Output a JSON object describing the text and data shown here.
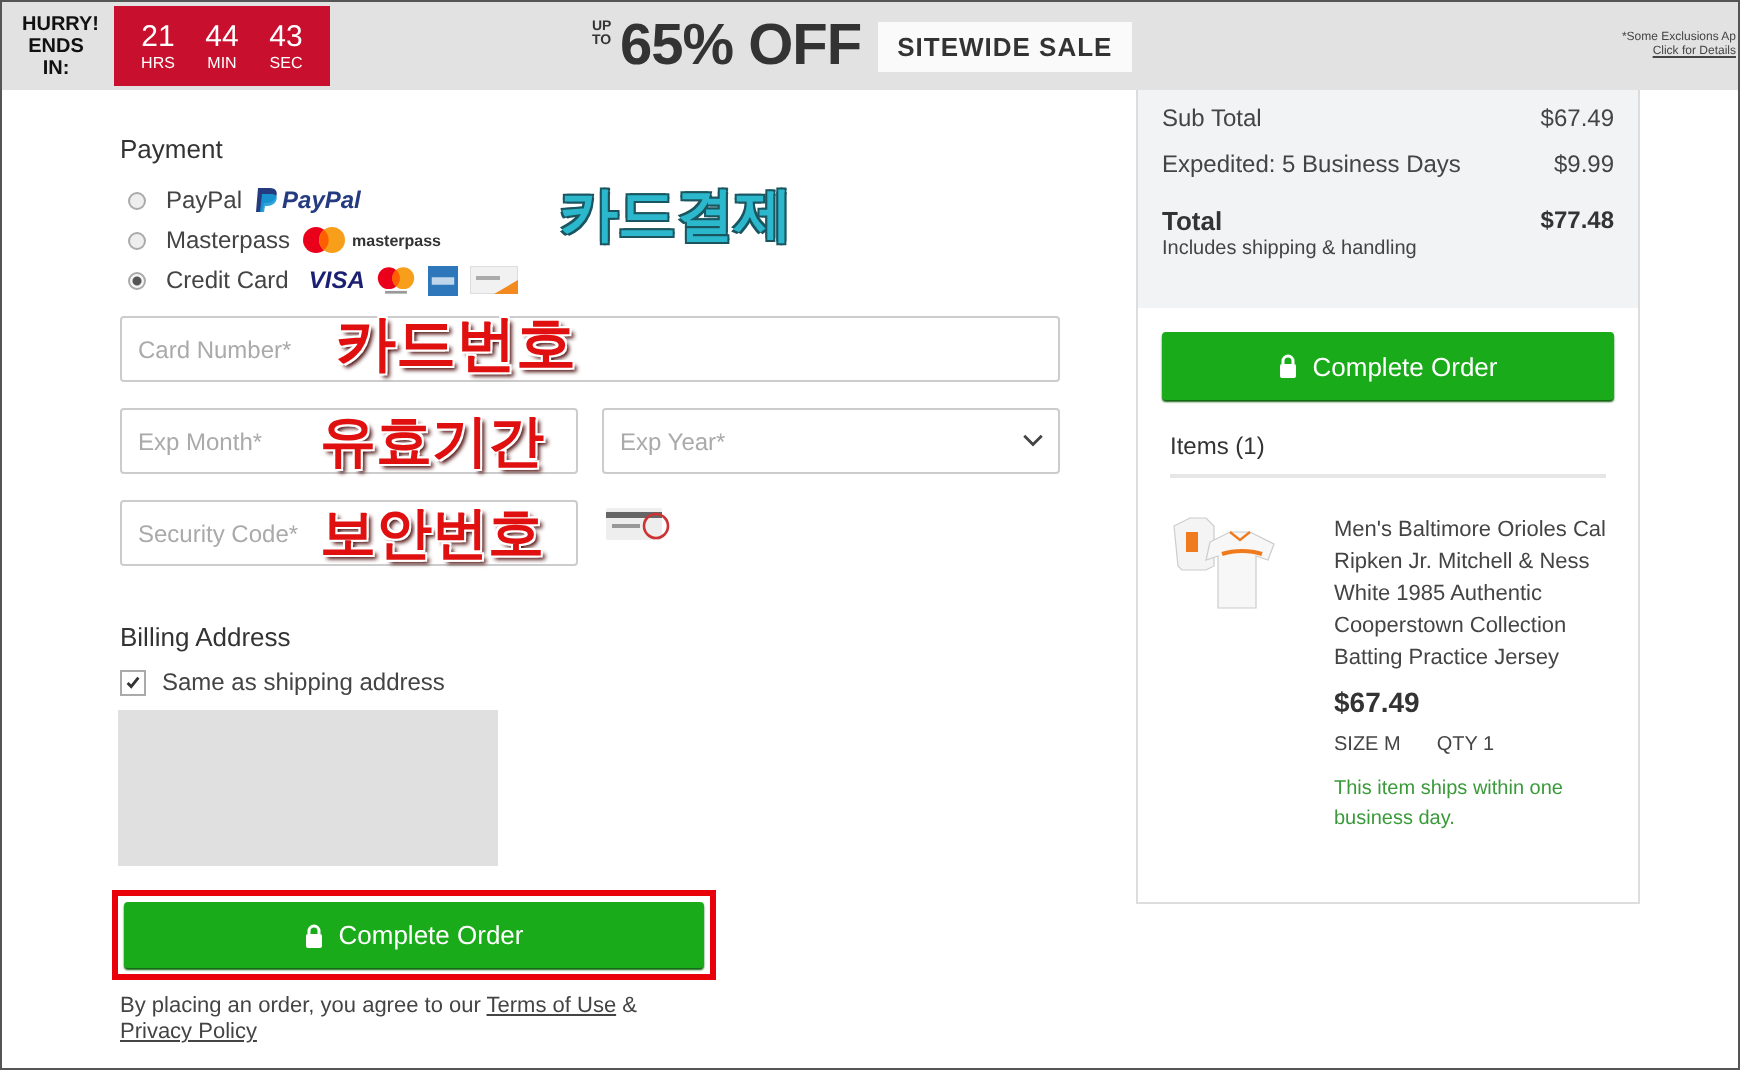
{
  "banner": {
    "hurry": "HURRY! ENDS IN:",
    "countdown": [
      {
        "value": "21",
        "unit": "HRS"
      },
      {
        "value": "44",
        "unit": "MIN"
      },
      {
        "value": "43",
        "unit": "SEC"
      }
    ],
    "up_to": "UP TO",
    "offer": "65% OFF",
    "sale": "SITEWIDE SALE",
    "fine_print": "*Some Exclusions Ap",
    "details_link": "Click for Details"
  },
  "payment": {
    "title": "Payment",
    "methods": [
      {
        "label": "PayPal",
        "kind": "paypal",
        "logo_text": "PayPal",
        "selected": false
      },
      {
        "label": "Masterpass",
        "kind": "masterpass",
        "logo_text": "masterpass",
        "selected": false
      },
      {
        "label": "Credit Card",
        "kind": "cards",
        "logo_text": "VISA",
        "selected": true
      }
    ],
    "methods_annotation": {
      "text": "카드결제",
      "color": "#2bb8cc"
    },
    "card_number": {
      "placeholder": "Card Number*",
      "annotation": {
        "text": "카드번호",
        "color": "#e01010"
      }
    },
    "exp_month": {
      "placeholder": "Exp Month*",
      "annotation": {
        "text": "유효기간",
        "color": "#e01010"
      }
    },
    "exp_year": {
      "placeholder": "Exp Year*"
    },
    "security_code": {
      "placeholder": "Security Code*",
      "annotation": {
        "text": "보안번호",
        "color": "#e01010"
      }
    }
  },
  "billing": {
    "title": "Billing Address",
    "same_as_shipping": {
      "label": "Same as shipping address",
      "checked": true
    }
  },
  "complete_button": {
    "label": "Complete Order",
    "highlighted": true
  },
  "agreement": {
    "text": "By placing an order, you agree to our",
    "terms": "Terms of Use",
    "amp": "&",
    "privacy": "Privacy Policy"
  },
  "summary": {
    "rows": [
      {
        "label": "Sub Total",
        "value": "$67.49"
      },
      {
        "label": "Expedited: 5 Business Days",
        "value": "$9.99"
      }
    ],
    "total_label": "Total",
    "total_value": "$77.48",
    "total_note": "Includes shipping & handling",
    "button": "Complete Order",
    "items_title": "Items (1)",
    "item": {
      "kind": "picture",
      "name": "Men's Baltimore Orioles Cal Ripken Jr. Mitchell & Ness White 1985 Authentic Cooperstown Collection Batting Practice Jersey",
      "price": "$67.49",
      "size": "SIZE M",
      "qty": "QTY 1",
      "ship_note": "This item ships within one business day."
    }
  }
}
